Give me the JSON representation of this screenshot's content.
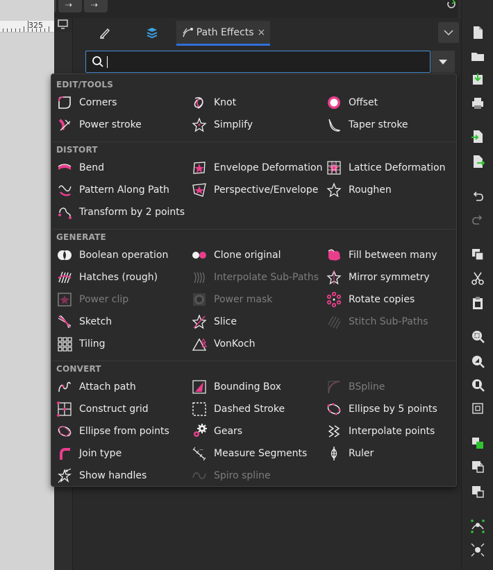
{
  "ruler": {
    "value": "325"
  },
  "tabs": [
    {
      "label": "",
      "icon": "pen-icon"
    },
    {
      "label": "",
      "icon": "layers-icon"
    },
    {
      "label": "Path Effects",
      "icon": "path-effects-icon",
      "close": "×"
    }
  ],
  "search": {
    "placeholder": "",
    "value": ""
  },
  "categories": [
    {
      "title": "EDIT/TOOLS",
      "items": [
        {
          "label": "Corners",
          "icon": "corners-icon",
          "enabled": true
        },
        {
          "label": "Knot",
          "icon": "knot-icon",
          "enabled": true
        },
        {
          "label": "Offset",
          "icon": "offset-icon",
          "enabled": true
        },
        {
          "label": "Power stroke",
          "icon": "power-stroke-icon",
          "enabled": true
        },
        {
          "label": "Simplify",
          "icon": "simplify-icon",
          "enabled": true
        },
        {
          "label": "Taper stroke",
          "icon": "taper-stroke-icon",
          "enabled": true
        }
      ]
    },
    {
      "title": "DISTORT",
      "items": [
        {
          "label": "Bend",
          "icon": "bend-icon",
          "enabled": true
        },
        {
          "label": "Envelope Deformation",
          "icon": "envelope-deformation-icon",
          "enabled": true
        },
        {
          "label": "Lattice Deformation",
          "icon": "lattice-deformation-icon",
          "enabled": true
        },
        {
          "label": "Pattern Along Path",
          "icon": "pattern-along-path-icon",
          "enabled": true
        },
        {
          "label": "Perspective/Envelope",
          "icon": "perspective-envelope-icon",
          "enabled": true
        },
        {
          "label": "Roughen",
          "icon": "roughen-icon",
          "enabled": true
        },
        {
          "label": "Transform by 2 points",
          "icon": "transform-2-points-icon",
          "enabled": true
        }
      ]
    },
    {
      "title": "GENERATE",
      "items": [
        {
          "label": "Boolean operation",
          "icon": "boolean-operation-icon",
          "enabled": true
        },
        {
          "label": "Clone original",
          "icon": "clone-original-icon",
          "enabled": true
        },
        {
          "label": "Fill between many",
          "icon": "fill-between-many-icon",
          "enabled": true
        },
        {
          "label": "Hatches (rough)",
          "icon": "hatches-icon",
          "enabled": true
        },
        {
          "label": "Interpolate Sub-Paths",
          "icon": "interpolate-subpaths-icon",
          "enabled": false
        },
        {
          "label": "Mirror symmetry",
          "icon": "mirror-symmetry-icon",
          "enabled": true
        },
        {
          "label": "Power clip",
          "icon": "power-clip-icon",
          "enabled": false
        },
        {
          "label": "Power mask",
          "icon": "power-mask-icon",
          "enabled": false
        },
        {
          "label": "Rotate copies",
          "icon": "rotate-copies-icon",
          "enabled": true
        },
        {
          "label": "Sketch",
          "icon": "sketch-icon",
          "enabled": true
        },
        {
          "label": "Slice",
          "icon": "slice-icon",
          "enabled": true
        },
        {
          "label": "Stitch Sub-Paths",
          "icon": "stitch-subpaths-icon",
          "enabled": false
        },
        {
          "label": "Tiling",
          "icon": "tiling-icon",
          "enabled": true
        },
        {
          "label": "VonKoch",
          "icon": "vonkoch-icon",
          "enabled": true
        }
      ]
    },
    {
      "title": "CONVERT",
      "items": [
        {
          "label": "Attach path",
          "icon": "attach-path-icon",
          "enabled": true
        },
        {
          "label": "Bounding Box",
          "icon": "bounding-box-icon",
          "enabled": true
        },
        {
          "label": "BSpline",
          "icon": "bspline-icon",
          "enabled": false
        },
        {
          "label": "Construct grid",
          "icon": "construct-grid-icon",
          "enabled": true
        },
        {
          "label": "Dashed Stroke",
          "icon": "dashed-stroke-icon",
          "enabled": true
        },
        {
          "label": "Ellipse by 5 points",
          "icon": "ellipse-5-points-icon",
          "enabled": true
        },
        {
          "label": "Ellipse from points",
          "icon": "ellipse-from-points-icon",
          "enabled": true
        },
        {
          "label": "Gears",
          "icon": "gears-icon",
          "enabled": true
        },
        {
          "label": "Interpolate points",
          "icon": "interpolate-points-icon",
          "enabled": true
        },
        {
          "label": "Join type",
          "icon": "join-type-icon",
          "enabled": true
        },
        {
          "label": "Measure Segments",
          "icon": "measure-segments-icon",
          "enabled": true
        },
        {
          "label": "Ruler",
          "icon": "ruler-icon",
          "enabled": true
        },
        {
          "label": "Show handles",
          "icon": "show-handles-icon",
          "enabled": true
        },
        {
          "label": "Spiro spline",
          "icon": "spiro-spline-icon",
          "enabled": false
        }
      ]
    }
  ],
  "right_toolbar": [
    {
      "icon": "new-document-icon"
    },
    {
      "icon": "open-folder-icon"
    },
    {
      "icon": "save-icon"
    },
    {
      "icon": "print-icon"
    },
    {
      "icon": "import-icon"
    },
    {
      "icon": "export-icon"
    },
    {
      "icon": "undo-icon"
    },
    {
      "icon": "redo-icon"
    },
    {
      "icon": "duplicate-icon"
    },
    {
      "icon": "cut-icon"
    },
    {
      "icon": "paste-icon"
    },
    {
      "icon": "zoom-selection-icon"
    },
    {
      "icon": "zoom-drawing-icon"
    },
    {
      "icon": "zoom-page-icon"
    },
    {
      "icon": "zoom-fit-icon"
    },
    {
      "icon": "group-icon"
    },
    {
      "icon": "lock-icon"
    },
    {
      "icon": "unlock-icon"
    },
    {
      "icon": "node-tool-icon"
    },
    {
      "icon": "snap-icon"
    }
  ],
  "colors": {
    "accent": "#e83e8c",
    "focus": "#4a90d9",
    "panel": "#2b2b2b",
    "text": "#ededed",
    "disabled": "#7d7d7d"
  }
}
